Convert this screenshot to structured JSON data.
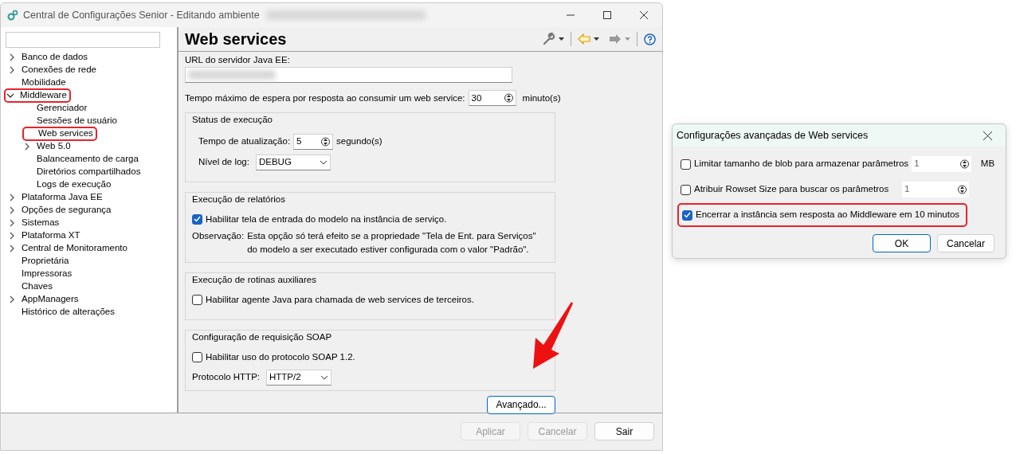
{
  "window": {
    "title": "Central de Configurações Senior - Editando ambiente"
  },
  "tree": [
    {
      "label": "Banco de dados",
      "expanded": false,
      "highlighted": false
    },
    {
      "label": "Conexões de rede",
      "expanded": false,
      "highlighted": false
    },
    {
      "label": "Mobilidade",
      "highlighted": false
    },
    {
      "label": "Middleware",
      "expanded": true,
      "highlighted": true,
      "children": [
        {
          "label": "Gerenciador",
          "highlighted": false
        },
        {
          "label": "Sessões de usuário",
          "highlighted": false
        },
        {
          "label": "Web services",
          "highlighted": true
        },
        {
          "label": "Web 5.0",
          "expanded": false,
          "highlighted": false
        },
        {
          "label": "Balanceamento de carga",
          "highlighted": false
        },
        {
          "label": "Diretórios compartilhados",
          "highlighted": false
        },
        {
          "label": "Logs de execução",
          "highlighted": false
        }
      ]
    },
    {
      "label": "Plataforma Java EE",
      "expanded": false,
      "highlighted": false
    },
    {
      "label": "Opções de segurança",
      "expanded": false,
      "highlighted": false
    },
    {
      "label": "Sistemas",
      "expanded": false,
      "highlighted": false
    },
    {
      "label": "Plataforma XT",
      "expanded": false,
      "highlighted": false
    },
    {
      "label": "Central de Monitoramento",
      "expanded": false,
      "highlighted": false
    },
    {
      "label": "Proprietária",
      "highlighted": false
    },
    {
      "label": "Impressoras",
      "highlighted": false
    },
    {
      "label": "Chaves",
      "highlighted": false
    },
    {
      "label": "AppManagers",
      "expanded": false,
      "highlighted": false
    },
    {
      "label": "Histórico de alterações",
      "highlighted": false
    }
  ],
  "page": {
    "title": "Web services",
    "url_field": {
      "label": "URL do servidor Java EE:"
    },
    "timeout": {
      "label": "Tempo máximo de espera por resposta ao consumir um web service:",
      "value": "30",
      "unit": "minuto(s)"
    },
    "groups": [
      {
        "title": "Status de execução",
        "rows": [
          {
            "kind": "spin",
            "label": "Tempo de atualização:",
            "value": "5",
            "unit": "segundo(s)"
          },
          {
            "kind": "select",
            "label": "Nível de log:",
            "value": "DEBUG"
          }
        ]
      },
      {
        "title": "Execução de relatórios",
        "rows": [
          {
            "kind": "checkbox",
            "label": "Habilitar tela de entrada do modelo na instância de serviço.",
            "checked": true
          },
          {
            "kind": "note",
            "label": "Observação:",
            "lines": [
              "Esta opção só terá efeito se a propriedade \"Tela de Ent. para Serviços\"",
              "do modelo a ser executado estiver configurada com o valor \"Padrão\"."
            ]
          }
        ]
      },
      {
        "title": "Execução de rotinas auxiliares",
        "rows": [
          {
            "kind": "checkbox",
            "label": "Habilitar agente Java para chamada de web services de terceiros.",
            "checked": false
          }
        ]
      },
      {
        "title": "Configuração de requisição SOAP",
        "rows": [
          {
            "kind": "checkbox",
            "label": "Habilitar uso do protocolo SOAP 1.2.",
            "checked": false
          },
          {
            "kind": "select",
            "label": "Protocolo HTTP:",
            "value": "HTTP/2"
          }
        ]
      }
    ],
    "advanced_button": {
      "label": "Avançado...",
      "focused": true
    }
  },
  "footer_buttons": [
    {
      "label": "Aplicar",
      "disabled": true
    },
    {
      "label": "Cancelar",
      "disabled": true
    },
    {
      "label": "Sair",
      "disabled": false
    }
  ],
  "dialog": {
    "title": "Configurações avançadas de Web services",
    "options": [
      {
        "label": "Limitar tamanho de blob para armazenar parâmetros",
        "checked": false,
        "value": "1",
        "unit": "MB",
        "highlighted": false
      },
      {
        "label": "Atribuir Rowset Size para buscar os parâmetros",
        "checked": false,
        "value": "1",
        "highlighted": false
      },
      {
        "label": "Encerrar a instância sem resposta ao Middleware em 10 minutos",
        "checked": true,
        "highlighted": true
      }
    ],
    "buttons": [
      {
        "label": "OK",
        "default": true
      },
      {
        "label": "Cancelar",
        "default": false
      }
    ]
  }
}
